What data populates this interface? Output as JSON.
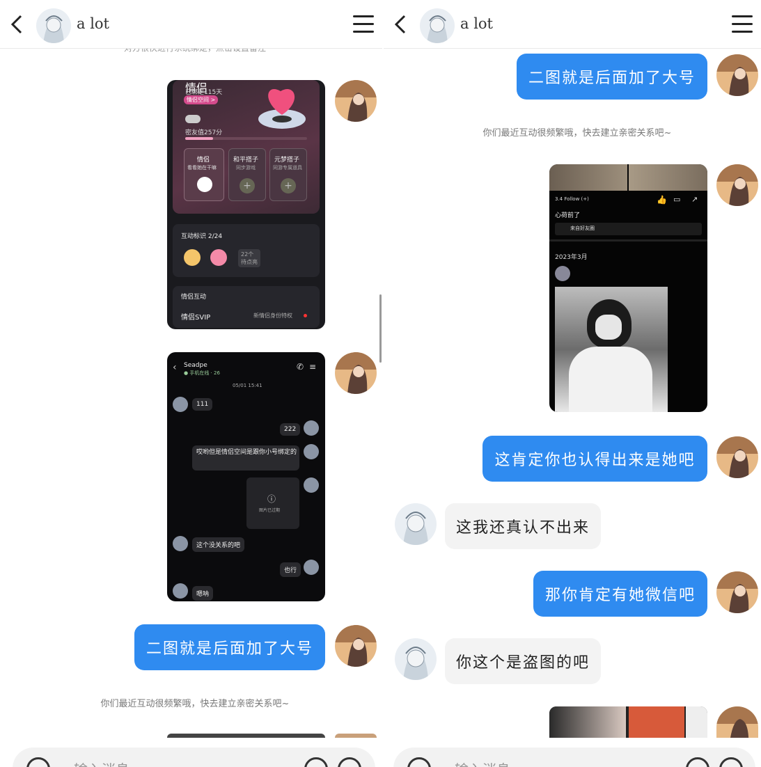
{
  "left": {
    "header": {
      "title": "a lot"
    },
    "sys_top": "对方很快进行系统绑定，点击设置备注",
    "shot1": {
      "heading": "情侣",
      "bound_days": "已绑定115天",
      "space_tag": "情侣空间 >",
      "score": "密友值257分",
      "cards": [
        {
          "title": "情侣",
          "sub": "看看她在干嘛"
        },
        {
          "title": "和平搭子",
          "sub": "同步游戏"
        },
        {
          "title": "元梦搭子",
          "sub": "同游专属道具"
        }
      ],
      "badges_label": "互动标识 2/24",
      "badges_more": "22个\n待点亮",
      "section_label": "情侣互动",
      "svip_label": "情侣SVIP",
      "svip_note": "新情侣身份特权"
    },
    "shot2": {
      "contact": "Seadpe",
      "status": "● 手机在线 · 26",
      "time": "05/01 15:41",
      "msgs": [
        {
          "side": "in",
          "text": "111"
        },
        {
          "side": "out",
          "text": "222"
        },
        {
          "side": "out",
          "text": "哎哟但是情侣空间是跟你小号绑定的"
        },
        {
          "side": "out",
          "text": "图片已过期"
        },
        {
          "side": "in",
          "text": "这个没关系的吧"
        },
        {
          "side": "out",
          "text": "也行"
        },
        {
          "side": "in",
          "text": "嗯呐"
        }
      ]
    },
    "bubble_out_1": "二图就是后面加了大号",
    "sys_bottom": "你们最近互动很频繁哦，快去建立亲密关系吧~",
    "input": {
      "placeholder": "输入消息"
    }
  },
  "right": {
    "header": {
      "title": "a lot"
    },
    "bubble_out_1": "二图就是后面加了大号",
    "sys": "你们最近互动很频繁哦，快去建立亲密关系吧~",
    "shot3": {
      "line1": "3.4 Follow (+)",
      "line2": "心荷前了",
      "line3": "来自好友圈",
      "date": "2023年3月"
    },
    "bubble_out_2": "这肯定你也认得出来是她吧",
    "bubble_in_1": "这我还真认不出来",
    "bubble_out_3": "那你肯定有她微信吧",
    "bubble_in_2": "你这个是盗图的吧",
    "input": {
      "placeholder": "输入消息"
    }
  },
  "colors": {
    "accent": "#2f8bf0",
    "in_bubble": "#f3f3f3"
  }
}
